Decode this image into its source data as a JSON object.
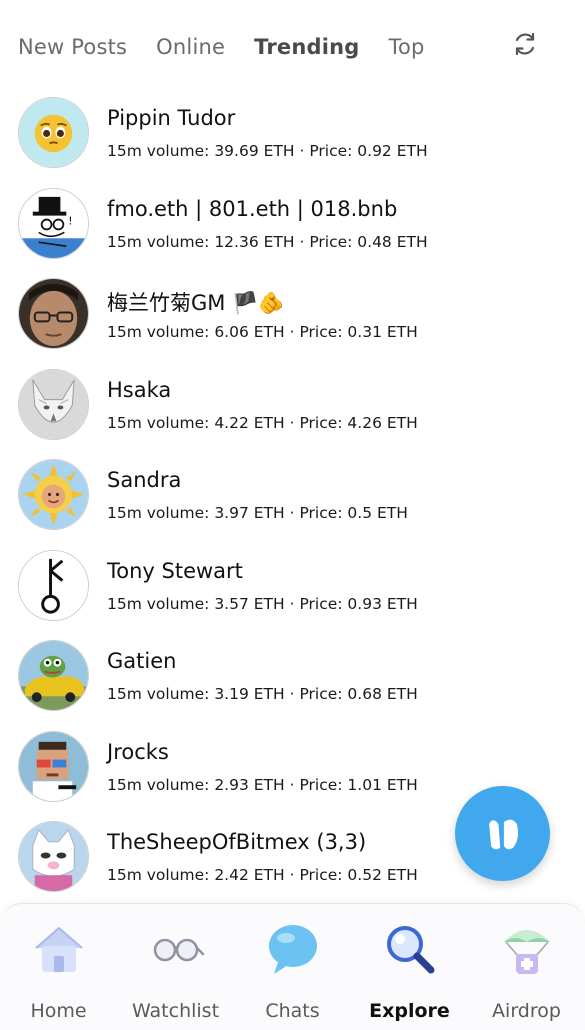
{
  "tabs": [
    {
      "label": "New Posts",
      "active": false
    },
    {
      "label": "Online",
      "active": false
    },
    {
      "label": "Trending",
      "active": true
    },
    {
      "label": "Top",
      "active": false
    }
  ],
  "refresh_icon": "refresh-icon",
  "users": [
    {
      "name": "Pippin Tudor",
      "stats": "15m volume: 39.69 ETH · Price: 0.92 ETH",
      "avatar": "pleading-face-emoji"
    },
    {
      "name": "fmo.eth | 801.eth | 018.bnb",
      "stats": "15m volume: 12.36 ETH · Price: 0.48 ETH",
      "avatar": "top-hat-stick-figure"
    },
    {
      "name": "梅兰竹菊GM 🏴🫵",
      "stats": "15m volume: 6.06 ETH · Price: 0.31 ETH",
      "avatar": "man-with-glasses-photo"
    },
    {
      "name": "Hsaka",
      "stats": "15m volume: 4.22 ETH · Price: 4.26 ETH",
      "avatar": "white-wolf"
    },
    {
      "name": "Sandra",
      "stats": "15m volume: 3.97 ETH · Price: 0.5 ETH",
      "avatar": "sun-baby"
    },
    {
      "name": "Tony Stewart",
      "stats": "15m volume: 3.57 ETH · Price: 0.93 ETH",
      "avatar": "key-symbol"
    },
    {
      "name": "Gatien",
      "stats": "15m volume: 3.19 ETH · Price: 0.68 ETH",
      "avatar": "pepe-in-car"
    },
    {
      "name": "Jrocks",
      "stats": "15m volume: 2.93 ETH · Price: 1.01 ETH",
      "avatar": "pixel-character-3d-glasses"
    },
    {
      "name": "TheSheepOfBitmex (3,3)",
      "stats": "15m volume: 2.42 ETH · Price: 0.52 ETH",
      "avatar": "white-cat-character"
    }
  ],
  "fab": {
    "icon": "friendtech-logo-icon",
    "color": "#41a8ee"
  },
  "bottom_nav": [
    {
      "label": "Home",
      "icon": "home-icon",
      "active": false
    },
    {
      "label": "Watchlist",
      "icon": "glasses-icon",
      "active": false
    },
    {
      "label": "Chats",
      "icon": "chat-bubble-icon",
      "active": false
    },
    {
      "label": "Explore",
      "icon": "magnifier-icon",
      "active": true
    },
    {
      "label": "Airdrop",
      "icon": "airdrop-parachute-icon",
      "active": false
    }
  ]
}
